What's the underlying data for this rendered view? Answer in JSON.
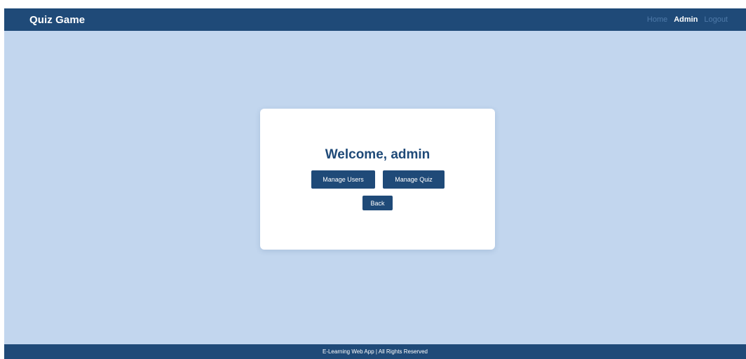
{
  "navbar": {
    "brand": "Quiz Game",
    "links": [
      {
        "label": "Home",
        "active": false
      },
      {
        "label": "Admin",
        "active": true
      },
      {
        "label": "Logout",
        "active": false
      }
    ]
  },
  "main": {
    "welcome": "Welcome, admin",
    "buttons": {
      "manage_users": "Manage Users",
      "manage_quiz": "Manage Quiz",
      "back": "Back"
    }
  },
  "footer": {
    "text": "E-Learning Web App | All Rights Reserved"
  },
  "colors": {
    "navbar_bg": "#1f4a78",
    "page_bg": "#c2d6ee",
    "card_bg": "#ffffff",
    "button_bg": "#1f4a78",
    "inactive_link": "#4f7aa9"
  }
}
